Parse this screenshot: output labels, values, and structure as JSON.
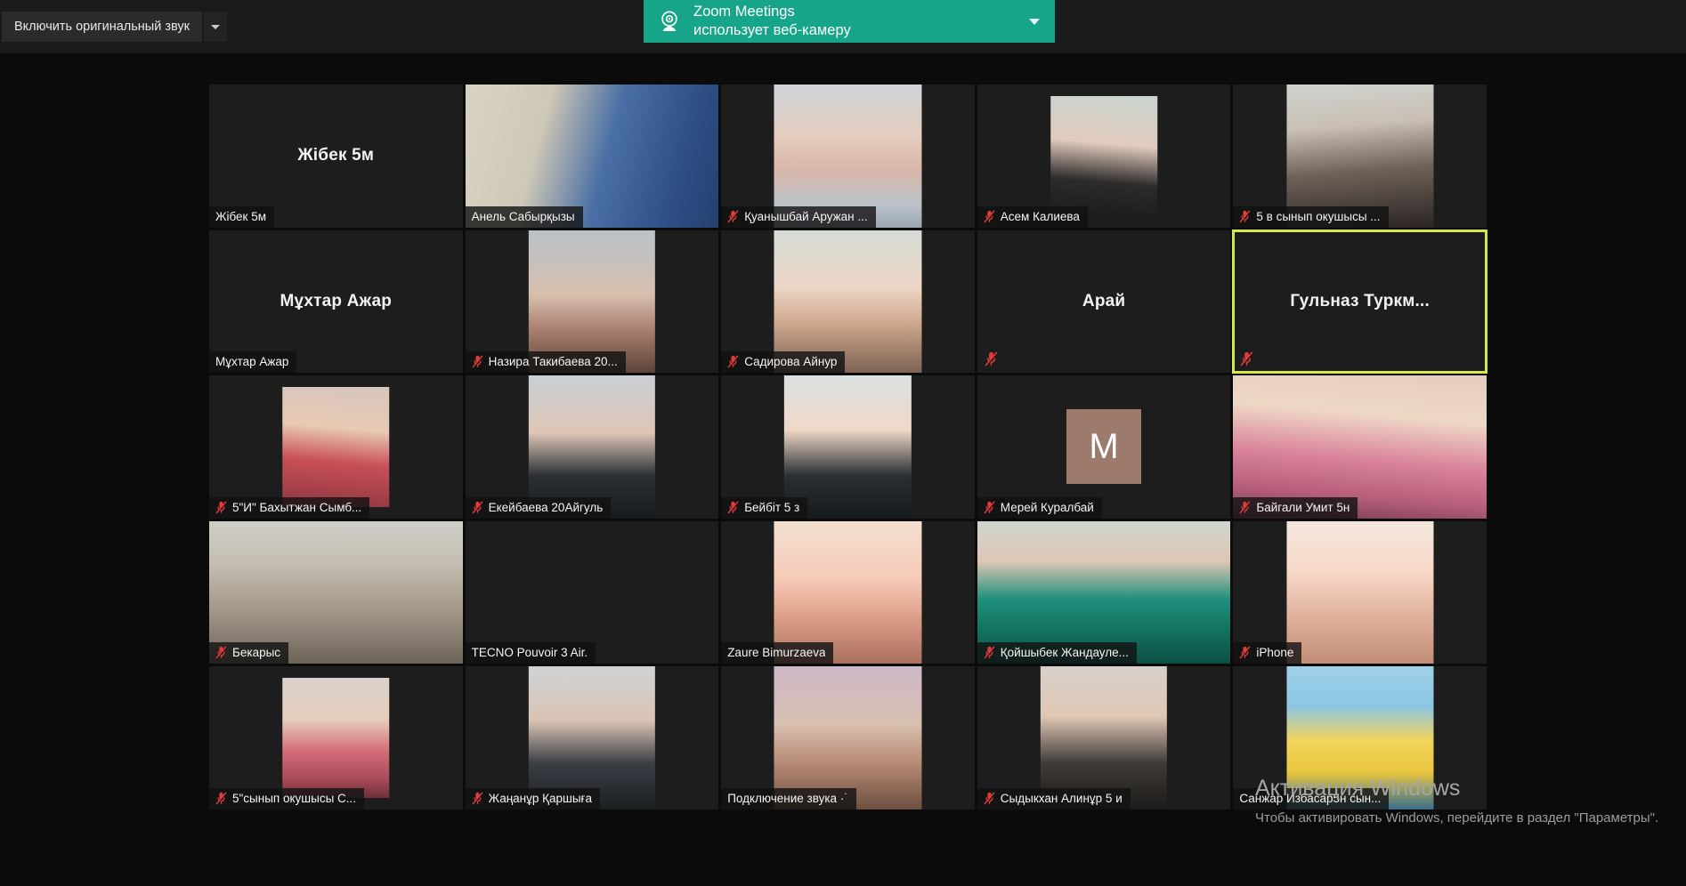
{
  "window": {
    "background_color": "#0b0b0b",
    "topbar_color": "#1a1a1a"
  },
  "topbar": {
    "original_sound_label": "Включить оригинальный звук",
    "caret_icon": "chevron-down-icon"
  },
  "notification": {
    "app_name": "Zoom Meetings",
    "message": "использует веб-камеру",
    "icon": "webcam-icon",
    "chevron_icon": "chevron-down-icon",
    "background_color": "#17a589",
    "text_color": "#ffffff"
  },
  "gallery": {
    "columns": 5,
    "rows": 5,
    "active_speaker_border_color": "#d6e84a",
    "mute_icon_color": "#e03b3b",
    "tiles": [
      {
        "name": "Жібек 5м",
        "display": "name-only",
        "muted": false,
        "active": false,
        "video": false
      },
      {
        "name": "Анель Сабырқызы",
        "display": "video",
        "muted": false,
        "active": false,
        "video": true,
        "feed": "full",
        "tone": "g1b"
      },
      {
        "name": "Қуанышбай Аружан ...",
        "display": "video",
        "muted": true,
        "active": false,
        "video": true,
        "feed": "portrait",
        "tone": "g2"
      },
      {
        "name": "Асем Калиева",
        "display": "video",
        "muted": true,
        "active": false,
        "video": true,
        "feed": "mid",
        "tone": "g3"
      },
      {
        "name": "5 в сынып окушысы ...",
        "display": "video",
        "muted": true,
        "active": false,
        "video": true,
        "feed": "portrait",
        "tone": "g4"
      },
      {
        "name": "Мұхтар Ажар",
        "display": "name-only",
        "muted": false,
        "active": false,
        "video": false
      },
      {
        "name": "Назира Такибаева 20...",
        "display": "video",
        "muted": true,
        "active": false,
        "video": true,
        "feed": "portrait-tall",
        "tone": "g5"
      },
      {
        "name": "Садирова Айнур",
        "display": "video",
        "muted": true,
        "active": false,
        "video": true,
        "feed": "portrait",
        "tone": "g6"
      },
      {
        "name": "Арай",
        "display": "name-only-muted",
        "muted": true,
        "active": false,
        "video": false
      },
      {
        "name": "Гульназ  Туркм...",
        "display": "name-only-muted",
        "muted": true,
        "active": true,
        "video": false
      },
      {
        "name": "5\"И\" Бахытжан Сымб...",
        "display": "video",
        "muted": true,
        "active": false,
        "video": true,
        "feed": "mid",
        "tone": "g9"
      },
      {
        "name": "Екейбаева 20Айгуль",
        "display": "video",
        "muted": true,
        "active": false,
        "video": true,
        "feed": "portrait-tall",
        "tone": "g10"
      },
      {
        "name": "Бейбіт 5 з",
        "display": "video",
        "muted": true,
        "active": false,
        "video": true,
        "feed": "portrait-tall",
        "tone": "g11"
      },
      {
        "name": "Мерей Куралбай",
        "display": "avatar",
        "avatar_letter": "M",
        "avatar_color": "#9c7b6c",
        "muted": true,
        "active": false,
        "video": false
      },
      {
        "name": "Байгали Умит 5н",
        "display": "video",
        "muted": true,
        "active": false,
        "video": true,
        "feed": "full",
        "tone": "g12"
      },
      {
        "name": "Бекарыс",
        "display": "video",
        "muted": true,
        "active": false,
        "video": true,
        "feed": "full",
        "tone": "g13"
      },
      {
        "name": "TECNO Pouvoir 3 Air.",
        "display": "name-bar-only",
        "muted": false,
        "active": false,
        "video": false
      },
      {
        "name": "Zaure Bimurzaeva",
        "display": "video",
        "muted": false,
        "active": false,
        "video": true,
        "feed": "portrait",
        "tone": "g14"
      },
      {
        "name": "Қойшыбек Жандауле...",
        "display": "video",
        "muted": true,
        "active": false,
        "video": true,
        "feed": "full",
        "tone": "g15"
      },
      {
        "name": "iPhone",
        "display": "video",
        "muted": true,
        "active": false,
        "video": true,
        "feed": "portrait",
        "tone": "g16"
      },
      {
        "name": "5\"сынып окушысы С...",
        "display": "video",
        "muted": true,
        "active": false,
        "video": true,
        "feed": "mid",
        "tone": "g17"
      },
      {
        "name": "Жаңанұр Қаршыға",
        "display": "video",
        "muted": true,
        "active": false,
        "video": true,
        "feed": "portrait-tall",
        "tone": "g18"
      },
      {
        "name": "Подключение звука",
        "display": "video",
        "muted": false,
        "active": false,
        "video": true,
        "feed": "portrait",
        "tone": "g19",
        "connecting": true
      },
      {
        "name": "Сыдыкхан Алинұр 5 и",
        "display": "video",
        "muted": true,
        "active": false,
        "video": true,
        "feed": "portrait-tall",
        "tone": "g20"
      },
      {
        "name": "Санжар Избасар5н сын...",
        "display": "video",
        "muted": false,
        "active": false,
        "video": true,
        "feed": "portrait",
        "tone": "g21"
      }
    ]
  },
  "watermark": {
    "title": "Активация Windows",
    "subtitle": "Чтобы активировать Windows, перейдите в раздел \"Параметры\"."
  }
}
